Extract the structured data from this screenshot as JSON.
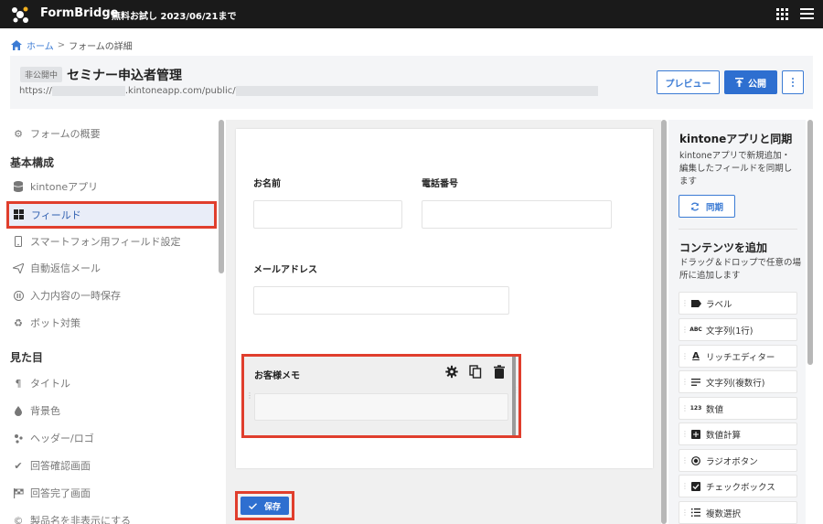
{
  "topbar": {
    "brand": "FormBridge",
    "trial": "無料お試し 2023/06/21まで"
  },
  "breadcrumb": {
    "home": "ホーム",
    "separator": ">",
    "current": "フォームの詳細"
  },
  "header": {
    "status_badge": "非公開中",
    "title": "セミナー申込者管理",
    "url_prefix": "https://",
    "url_domain": ".kintoneapp.com/public/",
    "preview_label": "プレビュー",
    "publish_label": "公開"
  },
  "sidebar": {
    "overview": "フォームの概要",
    "section_basic": "基本構成",
    "kintone_app": "kintoneアプリ",
    "fields": "フィールド",
    "smartphone": "スマートフォン用フィールド設定",
    "auto_reply": "自動返信メール",
    "temp_save": "入力内容の一時保存",
    "bot": "ボット対策",
    "section_look": "見た目",
    "title": "タイトル",
    "bg_color": "背景色",
    "header_logo": "ヘッダー/ロゴ",
    "confirm_screen": "回答確認画面",
    "complete_screen": "回答完了画面",
    "hide_product": "製品名を非表示にする"
  },
  "canvas": {
    "field_name": "お名前",
    "field_phone": "電話番号",
    "field_email": "メールアドレス",
    "field_memo": "お客様メモ",
    "save_label": "保存"
  },
  "right_panel": {
    "sync_title": "kintoneアプリと同期",
    "sync_desc": "kintoneアプリで新規追加・編集したフィールドを同期します",
    "sync_button": "同期",
    "add_title": "コンテンツを追加",
    "add_desc": "ドラッグ＆ドロップで任意の場所に追加します",
    "controls": [
      {
        "icon": "label-icon",
        "label": "ラベル"
      },
      {
        "icon": "text-single-icon",
        "label": "文字列(1行)"
      },
      {
        "icon": "rich-editor-icon",
        "label": "リッチエディター"
      },
      {
        "icon": "text-multi-icon",
        "label": "文字列(複数行)"
      },
      {
        "icon": "number-icon",
        "label": "数値"
      },
      {
        "icon": "calc-icon",
        "label": "数値計算"
      },
      {
        "icon": "radio-icon",
        "label": "ラジオボタン"
      },
      {
        "icon": "checkbox-icon",
        "label": "チェックボックス"
      },
      {
        "icon": "multi-select-icon",
        "label": "複数選択"
      }
    ]
  },
  "colors": {
    "accent": "#2e6fd0",
    "highlight": "#e03e2d",
    "topbar": "#1a1a1a"
  }
}
